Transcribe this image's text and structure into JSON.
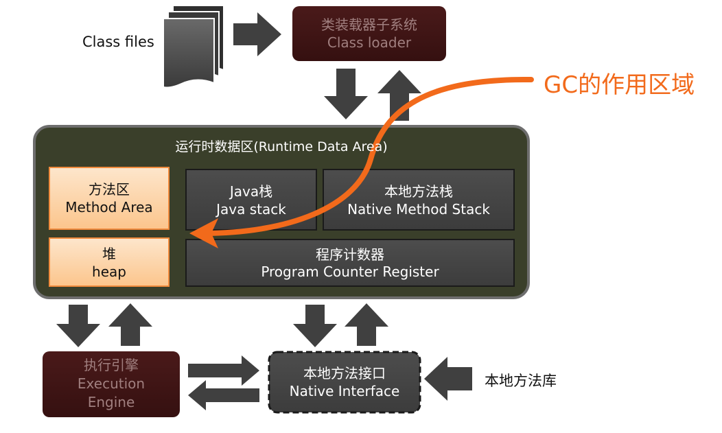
{
  "class_files": "Class files",
  "class_loader": {
    "zh": "类装载器子系统",
    "en": "Class loader"
  },
  "gc_label": "GC的作用区域",
  "runtime_area": {
    "title": "运行时数据区(Runtime Data Area)",
    "method_area": {
      "zh": "方法区",
      "en": "Method Area"
    },
    "heap": {
      "zh": "堆",
      "en": "heap"
    },
    "java_stack": {
      "zh": "Java栈",
      "en": "Java stack"
    },
    "native_stack": {
      "zh": "本地方法栈",
      "en": "Native Method Stack"
    },
    "pc_register": {
      "zh": "程序计数器",
      "en": "Program Counter Register"
    }
  },
  "execution_engine": {
    "line1": "执行引擎",
    "line2": "Execution",
    "line3": "Engine"
  },
  "native_interface": {
    "zh": "本地方法接口",
    "en": "Native Interface"
  },
  "native_library": "本地方法库",
  "colors": {
    "dark_red_box": "#3f1414",
    "runtime_bg": "#3a3f2a",
    "grey_box": "#474747",
    "orange_box": "#fdd7ad",
    "gc_orange": "#f26a1b",
    "arrow": "#404040"
  }
}
